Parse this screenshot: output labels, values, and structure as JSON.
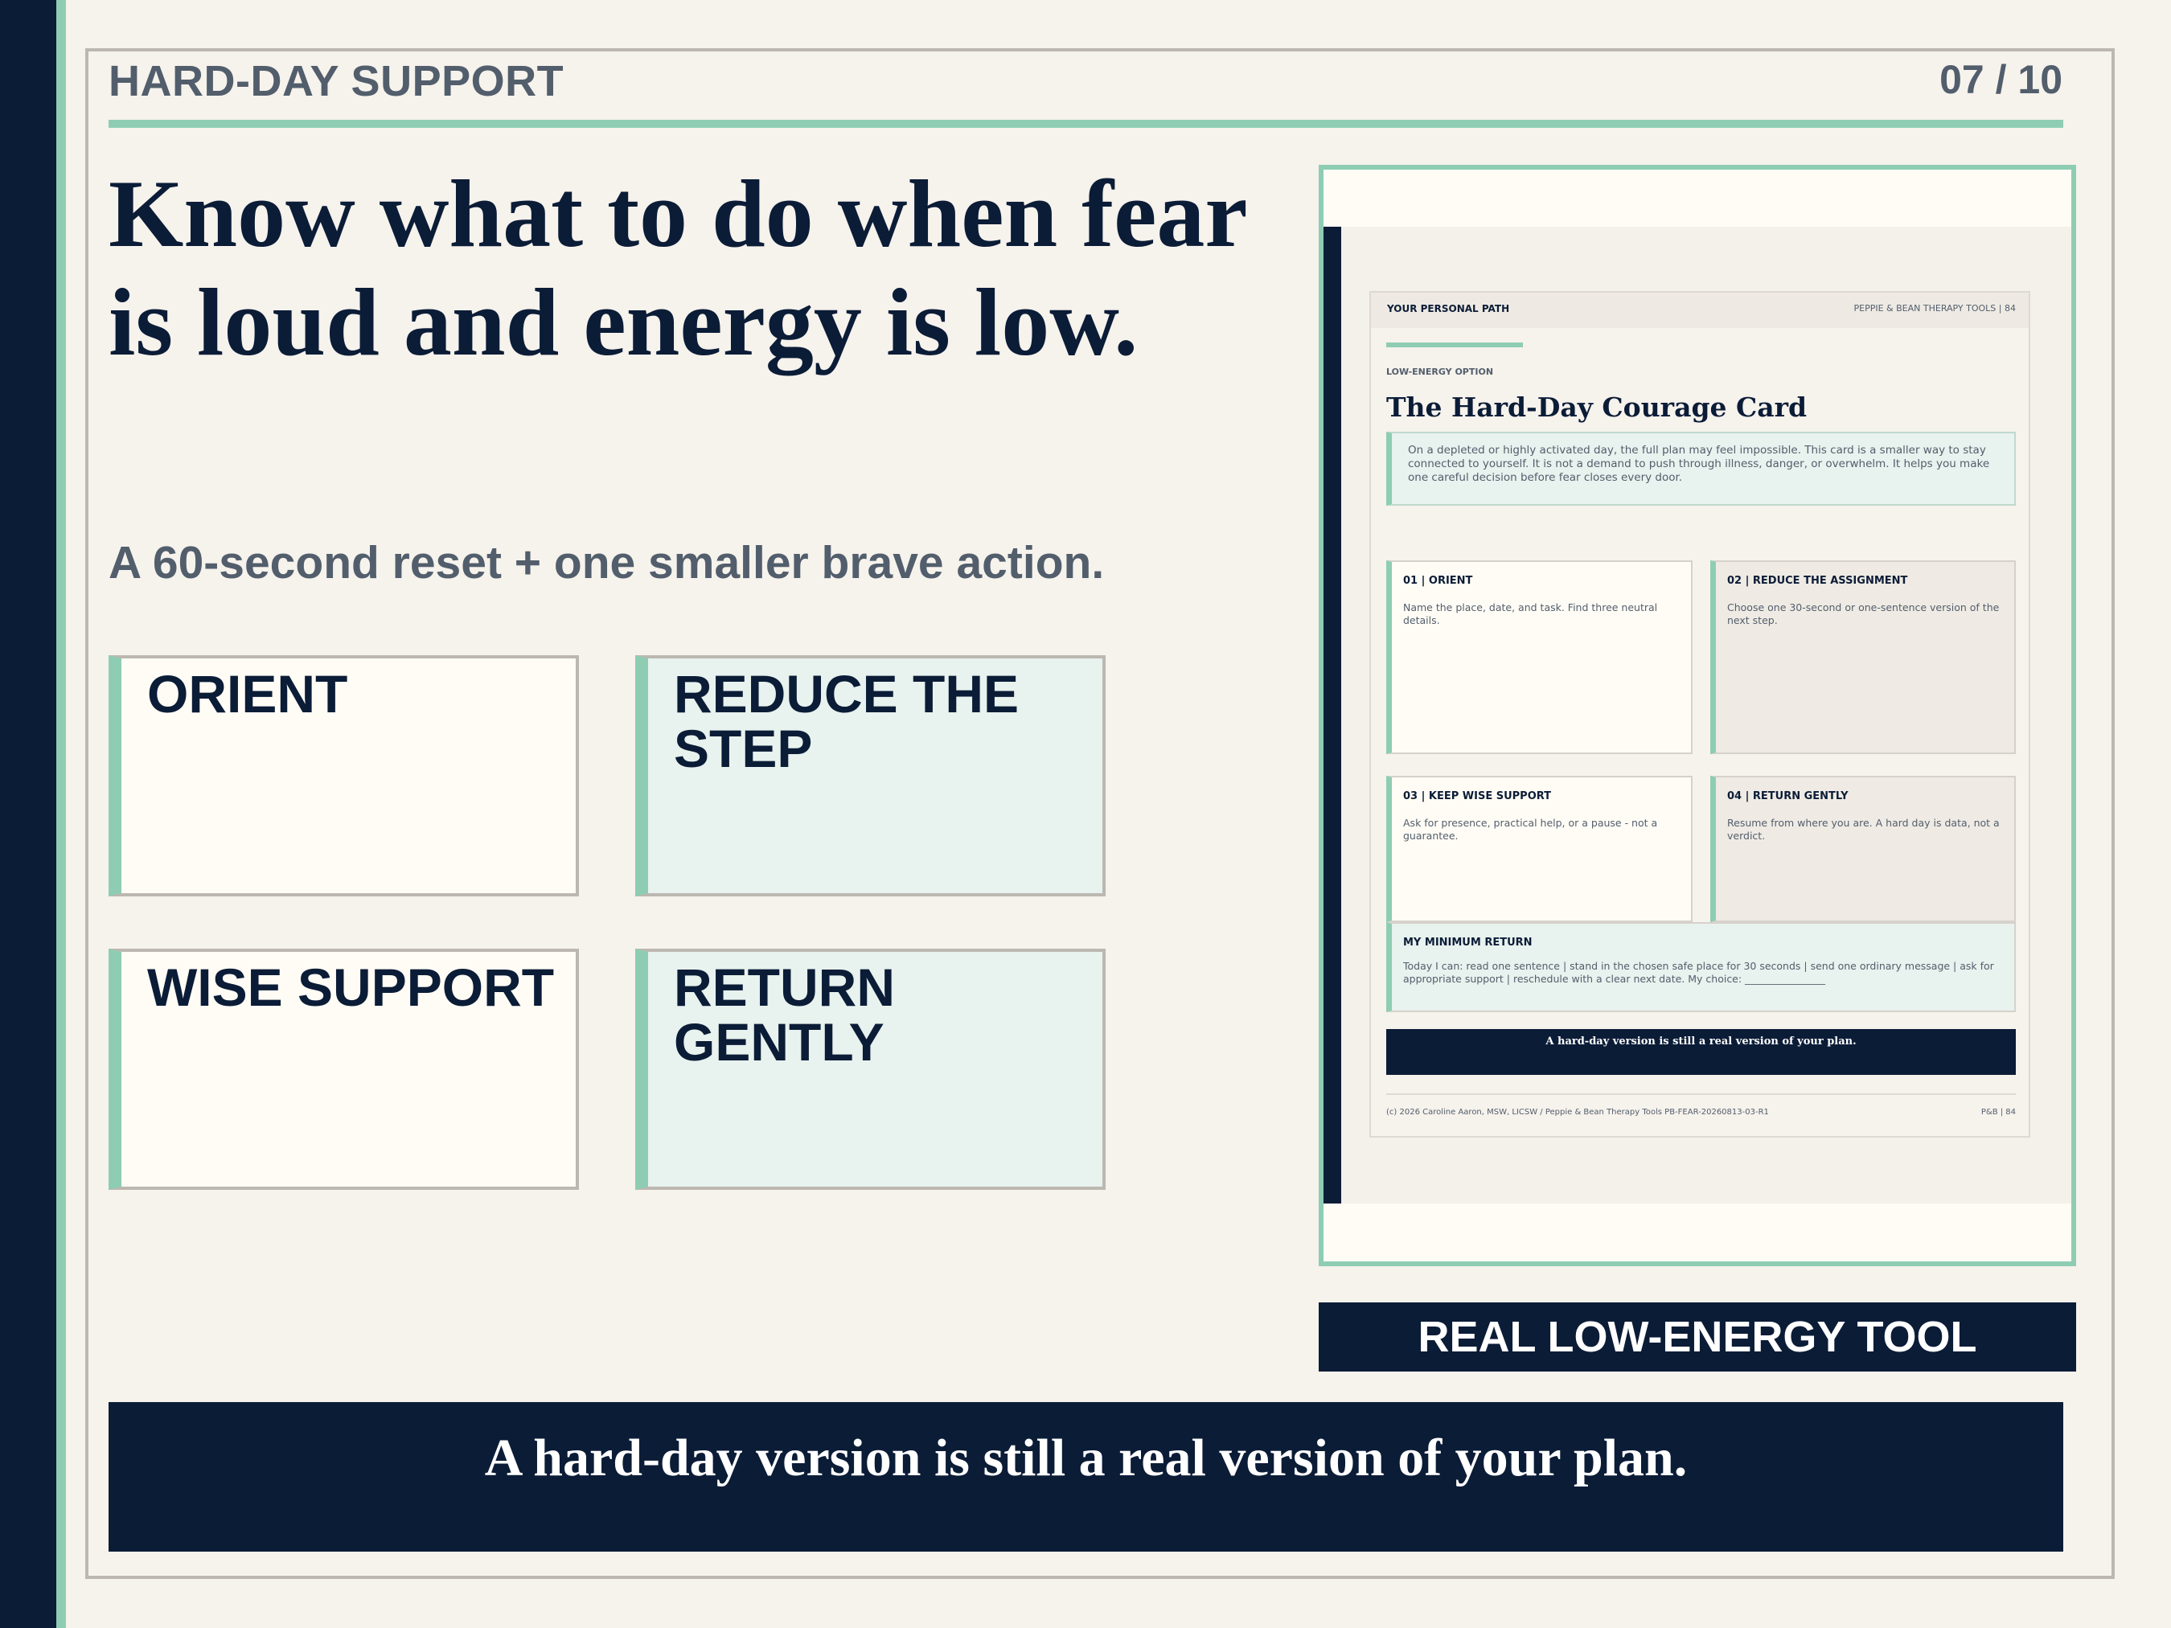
{
  "header": {
    "section_label": "HARD-DAY SUPPORT",
    "page_number": "07 / 10"
  },
  "main": {
    "headline": "Know what to do when fear is loud and energy is low.",
    "subline": "A 60-second reset + one smaller brave action.",
    "cards": [
      {
        "title": "ORIENT"
      },
      {
        "title": "REDUCE THE STEP"
      },
      {
        "title": "WISE SUPPORT"
      },
      {
        "title": "RETURN GENTLY"
      }
    ]
  },
  "preview": {
    "header_left": "YOUR PERSONAL PATH",
    "header_right": "PEPPIE & BEAN THERAPY TOOLS   |   84",
    "kicker": "LOW-ENERGY OPTION",
    "title": "The Hard-Day Courage Card",
    "intro": "On a depleted or highly activated day, the full plan may feel impossible. This card is a smaller way to stay connected to yourself. It is not a demand to push through illness, danger, or overwhelm. It helps you make one careful decision before fear closes every door.",
    "steps": [
      {
        "heading": "01 | ORIENT",
        "body": "Name the place, date, and task. Find three neutral details."
      },
      {
        "heading": "02 | REDUCE THE ASSIGNMENT",
        "body": "Choose one 30-second or one-sentence version of the next step."
      },
      {
        "heading": "03 | KEEP WISE SUPPORT",
        "body": "Ask for presence, practical help, or a pause - not a guarantee."
      },
      {
        "heading": "04 | RETURN GENTLY",
        "body": "Resume from where you are. A hard day is data, not a verdict."
      }
    ],
    "minimum_return": {
      "heading": "MY MINIMUM RETURN",
      "body": "Today I can: read one sentence | stand in the chosen safe place for 30 seconds | send one ordinary message | ask for appropriate support | reschedule with a clear next date. My choice: ________________"
    },
    "band": "A hard-day version is still a real version of your plan.",
    "footer_left": "(c) 2026 Caroline Aaron, MSW, LICSW / Peppie & Bean Therapy Tools       PB-FEAR-20260813-03-R1",
    "footer_right": "P&B | 84"
  },
  "tool_label": "REAL LOW-ENERGY TOOL",
  "bottom_banner": "A hard-day version is still a real version of your plan.",
  "colors": {
    "navy": "#0b1c37",
    "mint": "#8ecdb3",
    "slate": "#525e6c",
    "background": "#f6f2ec",
    "cream": "#fffcf5",
    "mint_tint": "#e8f2ee"
  }
}
